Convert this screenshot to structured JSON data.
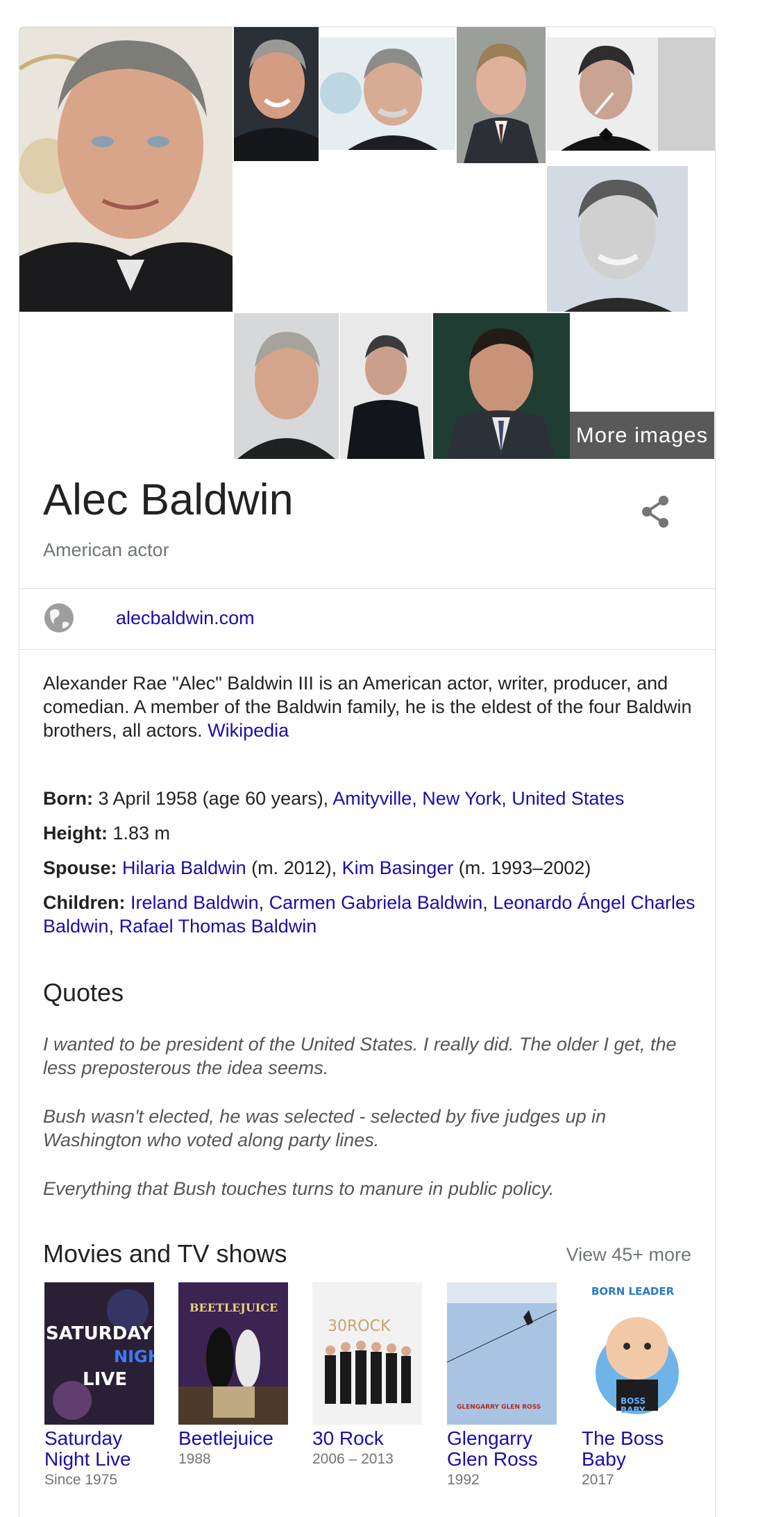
{
  "images": {
    "more_label": "More images"
  },
  "header": {
    "title": "Alec Baldwin",
    "subtitle": "American actor"
  },
  "website": {
    "label": "alecbaldwin.com"
  },
  "description": {
    "text": "Alexander Rae \"Alec\" Baldwin III is an American actor, writer, producer, and comedian. A member of the Baldwin family, he is the eldest of the four Baldwin brothers, all actors. ",
    "source": "Wikipedia"
  },
  "facts": {
    "born": {
      "label": "Born:",
      "text": " 3 April 1958 (age 60 years), ",
      "place": "Amityville, New York, United States"
    },
    "height": {
      "label": "Height:",
      "value": " 1.83 m"
    },
    "spouse": {
      "label": "Spouse:",
      "s1_name": "Hilaria Baldwin",
      "s1_years": " (m. 2012), ",
      "s2_name": "Kim Basinger",
      "s2_years": " (m. 1993–2002)"
    },
    "children": {
      "label": "Children:",
      "c1": "Ireland Baldwin",
      "c2": "Carmen Gabriela Baldwin",
      "c3": "Leonardo Ángel Charles Baldwin",
      "c4": "Rafael Thomas Baldwin",
      "sep": ", "
    }
  },
  "quotes": {
    "heading": "Quotes",
    "items": [
      "I wanted to be president of the United States. I really did. The older I get, the less preposterous the idea seems.",
      "Bush wasn't elected, he was selected - selected by five judges up in Washington who voted along party lines.",
      "Everything that Bush touches turns to manure in public policy."
    ]
  },
  "movies": {
    "heading": "Movies and TV shows",
    "view_more": "View 45+ more",
    "items": [
      {
        "title": "Saturday Night Live",
        "year": "Since 1975",
        "poster_text": [
          "SATURDAY",
          "NIGHT",
          "LIVE"
        ]
      },
      {
        "title": "Beetlejuice",
        "year": "1988",
        "poster_text": [
          "BEETLEJUICE"
        ]
      },
      {
        "title": "30 Rock",
        "year": "2006 – 2013",
        "poster_text": [
          "30ROCK"
        ]
      },
      {
        "title": "Glengarry Glen Ross",
        "year": "1992",
        "poster_text": [
          "GLENGARRY GLEN ROSS"
        ]
      },
      {
        "title": "The Boss Baby",
        "year": "2017",
        "poster_text": [
          "BORN LEADER",
          "BOSS",
          "BABY"
        ]
      }
    ]
  },
  "colors": {
    "link": "#1a0dab",
    "muted": "#70757a",
    "border": "#dadce0"
  }
}
